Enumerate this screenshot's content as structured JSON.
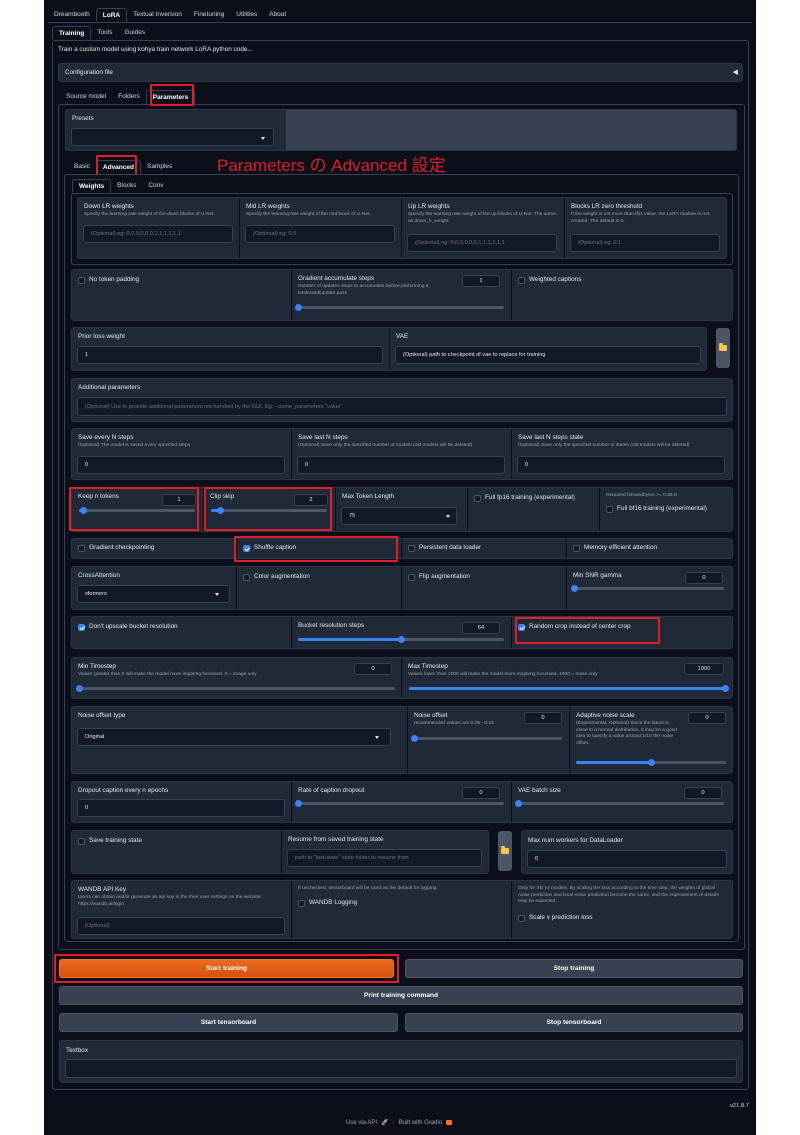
{
  "top_tabs": [
    "Dreambooth",
    "LoRA",
    "Textual Inversion",
    "Finetuning",
    "Utilities",
    "About"
  ],
  "sub_tabs": [
    "Training",
    "Tools",
    "Guides"
  ],
  "description": "Train a custom model using kohya train network LoRA python code...",
  "config_file": "Configuration file",
  "config_arrow": "◀",
  "section_tabs": [
    "Source model",
    "Folders",
    "Parameters"
  ],
  "presets": {
    "label": "Presets"
  },
  "param_tabs": [
    "Basic",
    "Advanced",
    "Samples"
  ],
  "annotation": "Parameters の Advanced 設定",
  "weight_tabs": [
    "Weights",
    "Blocks",
    "Conv"
  ],
  "lr_weights": [
    {
      "label": "Down LR weights",
      "hint": "Specify the learning rate weight of the down blocks of U-Net.",
      "placeholder": "(Optional) eg: 0,0,0,0,0,0,1,1,1,1,1,1"
    },
    {
      "label": "Mid LR weights",
      "hint": "Specify the learning rate weight of the mid block of U-Net.",
      "placeholder": "(Optional) eg: 0.5"
    },
    {
      "label": "Up LR weights",
      "hint": "Specify the learning rate weight of the up blocks of U-Net. The same as down_lr_weight.",
      "placeholder": "(Optional) eg: 0,0,0,0,0,0,1,1,1,1,1,1"
    },
    {
      "label": "Blocks LR zero threshold",
      "hint": "If the weight is not more than this value, the LoRA module is not created. The default is 0.",
      "placeholder": "(Optional) eg: 0.1"
    }
  ],
  "no_token_padding": "No token padding",
  "grad_accum": {
    "label": "Gradient accumulate steps",
    "hint": "Number of updates steps to accumulate before performing a backward/update pass",
    "value": "1",
    "fraction": 0.0
  },
  "weighted_captions": "Weighted captions",
  "prior_loss": {
    "label": "Prior loss weight",
    "value": "1"
  },
  "vae": {
    "label": "VAE",
    "value": "(Optional) path to checkpoint of vae to replace for training"
  },
  "additional": {
    "label": "Additional parameters",
    "placeholder": "(Optional) Use to provide additional parameters not handled by the GUI. Eg: --some_parameters \"value\""
  },
  "save_every": {
    "label": "Save every N steps",
    "hint": "(Optional) The model is saved every specified steps",
    "value": "0"
  },
  "save_last": {
    "label": "Save last N steps",
    "hint": "(Optional) Save only the specified number of models (old models will be deleted)",
    "value": "0"
  },
  "save_last_state": {
    "label": "Save last N steps state",
    "hint": "(Optional) Save only the specified number of states (old models will be deleted)",
    "value": "0"
  },
  "keep_tokens": {
    "label": "Keep n tokens",
    "value": "1",
    "fraction": 0.04
  },
  "clip_skip": {
    "label": "Clip skip",
    "value": "2",
    "fraction": 0.08
  },
  "max_token": {
    "label": "Max Token Length",
    "value": "75"
  },
  "full_fp16": "Full fp16 training (experimental)",
  "bnb_note": "Required bitsandbytes >= 0.36.0",
  "full_bf16": "Full bf16 training (experimental)",
  "grad_ckpt": "Gradient checkpointing",
  "shuffle": "Shuffle caption",
  "persistent": "Persistent data loader",
  "mem_eff": "Memory efficient attention",
  "cross_attn": {
    "label": "CrossAttention",
    "value": "xformers"
  },
  "color_aug": "Color augmentation",
  "flip_aug": "Flip augmentation",
  "min_snr": {
    "label": "Min SNR gamma",
    "value": "0",
    "fraction": 0.0
  },
  "no_upscale": "Don't upscale bucket resolution",
  "bucket_steps": {
    "label": "Bucket resolution steps",
    "value": "64",
    "fraction": 0.5
  },
  "random_crop": "Random crop instead of center crop",
  "min_timestep": {
    "label": "Min Timestep",
    "hint": "Values greater than 0 will make the model more img2img focussed. 0 = image only",
    "value": "0",
    "fraction": 0.0
  },
  "max_timestep": {
    "label": "Max Timestep",
    "hint": "Values lower than 1000 will make the model more img2img focussed. 1000 = noise only",
    "value": "1000",
    "fraction": 1.0
  },
  "noise_type": {
    "label": "Noise offset type",
    "value": "Original"
  },
  "noise_offset": {
    "label": "Noise offset",
    "hint": "recommended values are 0.05 - 0.15",
    "value": "0",
    "fraction": 0.0
  },
  "adaptive_noise": {
    "label": "Adaptive noise scale",
    "hint": "(Experimental, Optional) Since the latent is close to a normal distribution, it may be a good idea to specify a value around 1/10 the noise offset.",
    "value": "0",
    "fraction": 0.5
  },
  "dropout_every": {
    "label": "Dropout caption every n epochs",
    "value": "0"
  },
  "caption_dropout": {
    "label": "Rate of caption dropout",
    "value": "0",
    "fraction": 0.0
  },
  "vae_batch": {
    "label": "VAE batch size",
    "value": "0",
    "fraction": 0.0
  },
  "save_state": "Save training state",
  "resume": {
    "label": "Resume from saved training state",
    "placeholder": "path to \"last-state\" state folder to resume from"
  },
  "max_workers": {
    "label": "Max num workers for DataLoader",
    "value": "0"
  },
  "wandb": {
    "label": "WANDB API Key",
    "hint": "Users can obtain and/or generate an api key in the their user settings on the website: https://wandb.ai/login",
    "placeholder": "(Optional)"
  },
  "tb_note": "If unchecked, tensorboard will be used as the default for logging.",
  "wandb_logging": "WANDB Logging",
  "vpred_note": "Only for SD v2 models. By scaling the loss according to the time step, the weights of global noise prediction and local noise prediction become the same, and the improvement of details may be expected.",
  "vpred": "Scale v prediction loss",
  "buttons": {
    "start": "Start training",
    "stop": "Stop training",
    "print": "Print training command",
    "start_tb": "Start tensorboard",
    "stop_tb": "Stop tensorboard"
  },
  "textbox": "Textbox",
  "version": "v21.8.7",
  "footer": {
    "api": "Use via API",
    "sep": "·",
    "built": "Built with Gradio"
  }
}
